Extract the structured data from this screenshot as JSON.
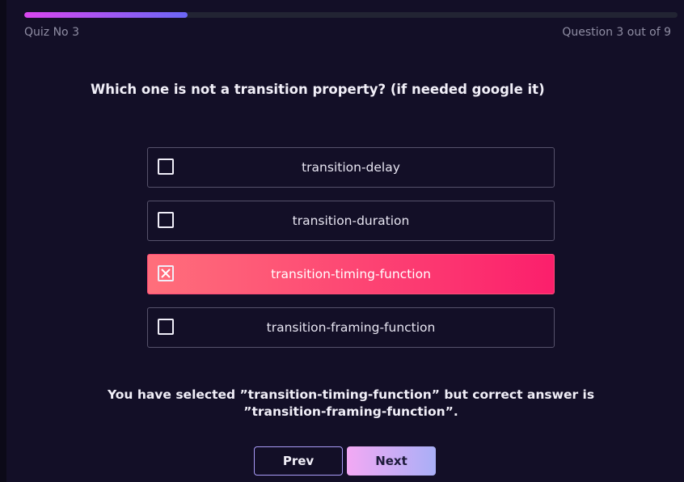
{
  "quiz": {
    "name": "Quiz No 3",
    "counter": "Question 3 out of 9",
    "progress": 0.25
  },
  "question": {
    "text": "Which one is not a transition property? (if needed google it)"
  },
  "options": [
    {
      "label": "transition-delay",
      "selected": false
    },
    {
      "label": "transition-duration",
      "selected": false
    },
    {
      "label": "transition-timing-function",
      "selected": true
    },
    {
      "label": "transition-framing-function",
      "selected": false
    }
  ],
  "feedback": {
    "line1": "You have selected ”transition-timing-function” but correct answer is",
    "line2": "”transition-framing-function”."
  },
  "nav": {
    "prev_label": "Prev",
    "next_label": "Next"
  },
  "colors": {
    "accent_gradient_start": "#d946ef",
    "accent_gradient_end": "#6b67f6",
    "selected_start": "#ff6f7b",
    "selected_end": "#fb1f6c",
    "background": "#130f27"
  },
  "icons": {
    "unchecked": "checkbox-empty-icon",
    "checked": "checkbox-x-icon"
  }
}
